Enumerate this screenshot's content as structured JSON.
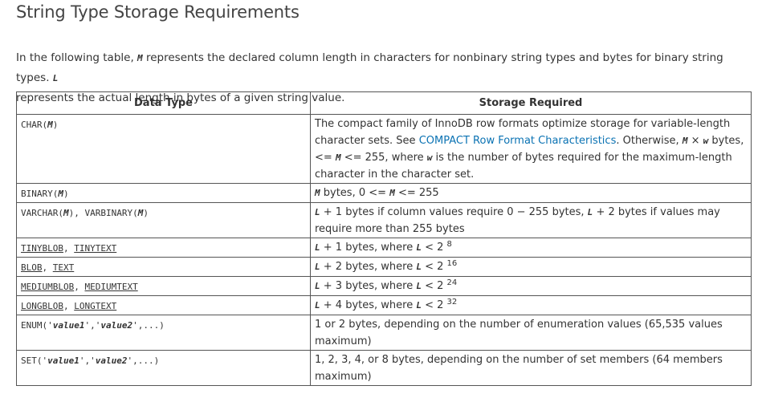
{
  "heading": "String Type Storage Requirements",
  "intro": {
    "p1": "In the following table,",
    "var_m": "M",
    "p2": "represents the declared column length in characters for nonbinary string types and bytes for binary string types.",
    "var_l": "L",
    "p3": "represents the actual length in bytes of a given string value."
  },
  "table": {
    "headers": [
      "Data Type",
      "Storage Required"
    ],
    "rows": [
      {
        "type_a": "CHAR(",
        "type_var": "M",
        "type_b": ")",
        "s1": "The compact family of InnoDB row formats optimize storage for variable-length character sets. See",
        "link": "COMPACT Row Format Characteristics",
        "s2": ". Otherwise,",
        "v1": "M",
        "times": "×",
        "v2": "w",
        "s3": "bytes, <=",
        "v3": "M",
        "s4": "<= 255, where",
        "v4": "w",
        "s5": "is the number of bytes required for the maximum-length character in the character set."
      },
      {
        "type_a": "BINARY(",
        "type_var": "M",
        "type_b": ")",
        "v1": "M",
        "s1": "bytes, 0 <=",
        "v2": "M",
        "s2": "<= 255"
      },
      {
        "type_a": "VARCHAR(",
        "type_var": "M",
        "type_b": "), VARBINARY(",
        "type_var2": "M",
        "type_c": ")",
        "v1": "L",
        "s1": "+ 1 bytes if column values require 0 − 255 bytes,",
        "v2": "L",
        "s2": "+ 2 bytes if values may require more than 255 bytes"
      },
      {
        "t1": "TINYBLOB",
        "sep": ",",
        "t2": "TINYTEXT",
        "v1": "L",
        "s1": "+ 1 bytes, where",
        "v2": "L",
        "s2": "< 2",
        "exp": "8"
      },
      {
        "t1": "BLOB",
        "sep": ",",
        "t2": "TEXT",
        "v1": "L",
        "s1": "+ 2 bytes, where",
        "v2": "L",
        "s2": "< 2",
        "exp": "16"
      },
      {
        "t1": "MEDIUMBLOB",
        "sep": ",",
        "t2": "MEDIUMTEXT",
        "v1": "L",
        "s1": "+ 3 bytes, where",
        "v2": "L",
        "s2": "< 2",
        "exp": "24"
      },
      {
        "t1": "LONGBLOB",
        "sep": ",",
        "t2": "LONGTEXT",
        "v1": "L",
        "s1": "+ 4 bytes, where",
        "v2": "L",
        "s2": "< 2",
        "exp": "32"
      },
      {
        "type_a": "ENUM('",
        "type_var": "value1",
        "type_b": "','",
        "type_var2": "value2",
        "type_c": "',...)",
        "s1": "1 or 2 bytes, depending on the number of enumeration values (65,535 values maximum)"
      },
      {
        "type_a": "SET('",
        "type_var": "value1",
        "type_b": "','",
        "type_var2": "value2",
        "type_c": "',...)",
        "s1": "1, 2, 3, 4, or 8 bytes, depending on the number of set members (64 members maximum)"
      }
    ]
  }
}
